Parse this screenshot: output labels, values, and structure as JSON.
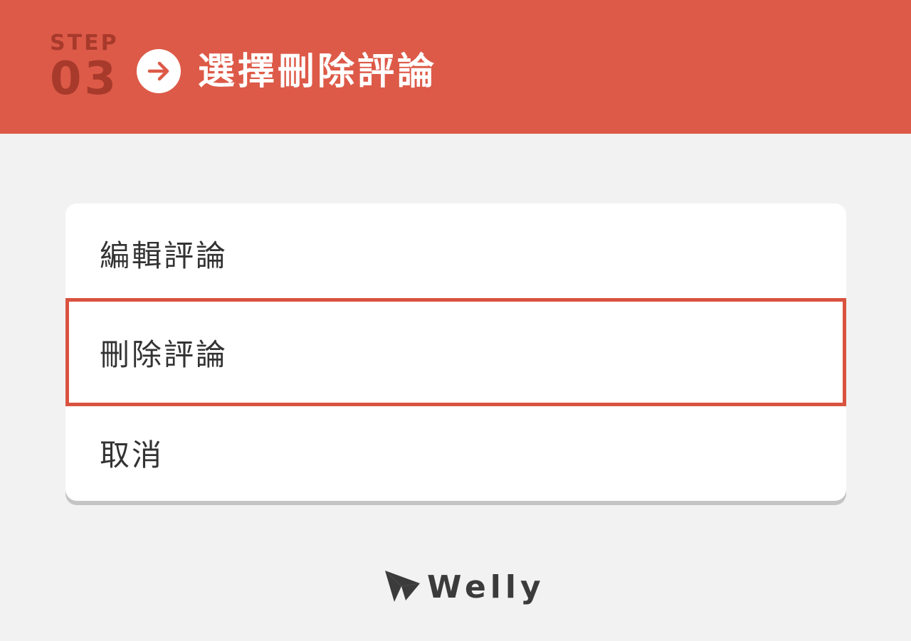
{
  "header": {
    "step_word": "STEP",
    "step_number": "03",
    "title": "選擇刪除評論",
    "arrow_icon": "arrow-right-icon",
    "background_color": "#dd5a48"
  },
  "menu": {
    "items": [
      {
        "label": "編輯評論",
        "highlighted": false
      },
      {
        "label": "刪除評論",
        "highlighted": true
      },
      {
        "label": "取消",
        "highlighted": false
      }
    ],
    "highlight_color": "#d9533f"
  },
  "logo": {
    "icon": "paper-plane-icon",
    "text": "Welly"
  }
}
